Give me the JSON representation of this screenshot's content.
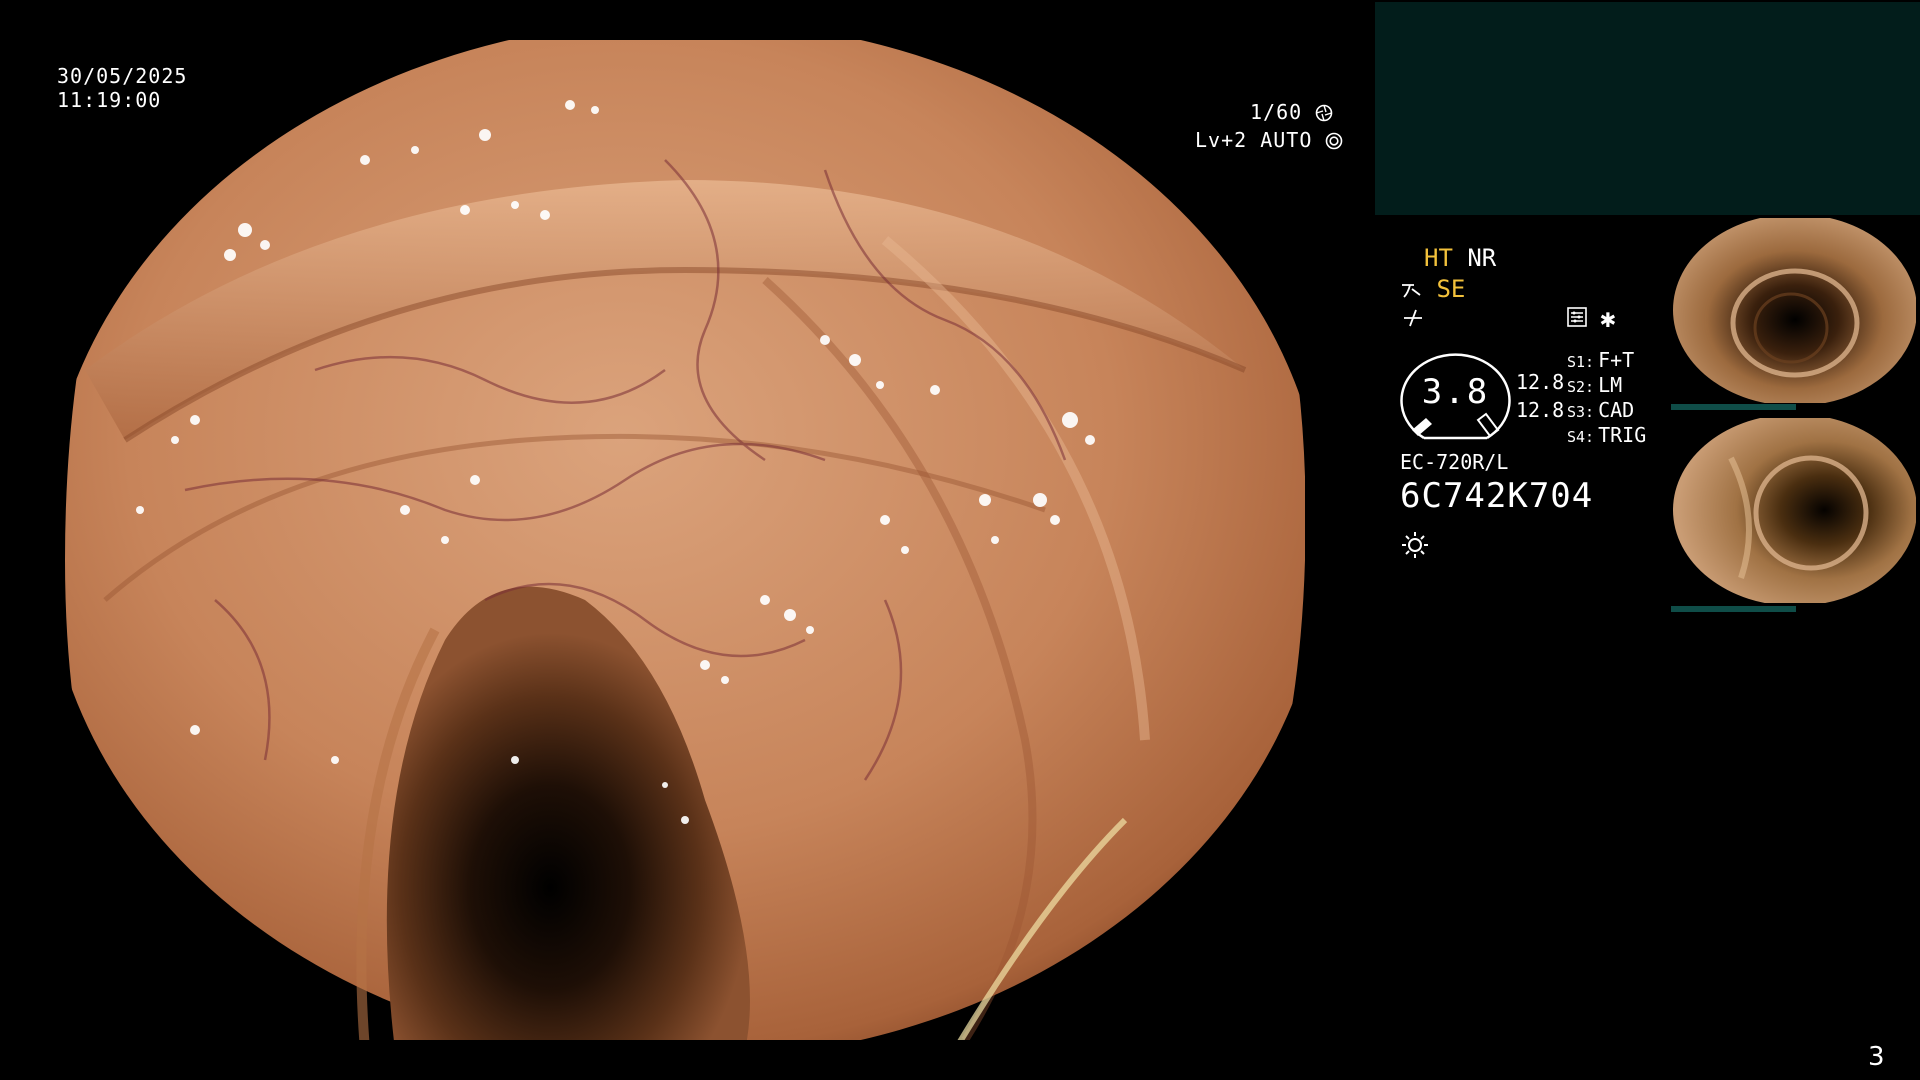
{
  "osd": {
    "date": "30/05/2025",
    "time": "11:19:00",
    "shutter": "1/60",
    "iris": "Lv+2 AUTO"
  },
  "status": {
    "ht": "HT",
    "nr": "NR",
    "se": "SE"
  },
  "gauge": {
    "value": "3.8",
    "value_top": "12.8",
    "value_bottom": "12.8"
  },
  "settings": [
    {
      "key": "S1:",
      "value": "F+T"
    },
    {
      "key": "S2:",
      "value": "LM"
    },
    {
      "key": "S3:",
      "value": "CAD"
    },
    {
      "key": "S4:",
      "value": "TRIG"
    }
  ],
  "scope": {
    "model": "EC-720R/L",
    "serial": "6C742K704"
  },
  "icons": {
    "shutter": "aperture-icon",
    "iris": "iris-auto-icon",
    "filter": "filter-icon",
    "flat": "flat-curve-icon",
    "settings": "settings-panel-icon",
    "asterisk": "asterisk-icon",
    "light": "light-source-icon"
  },
  "page_number": "3",
  "colors": {
    "accent_yellow": "#f2c13b",
    "top_panel": "#021d1b",
    "mucosa": "#c8895e"
  }
}
